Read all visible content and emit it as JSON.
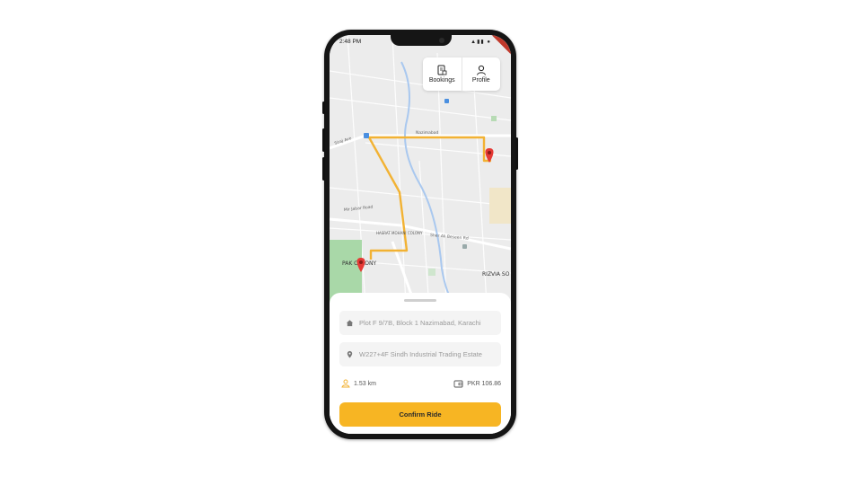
{
  "status_bar": {
    "time": "2:48 PM",
    "icons": "⚙"
  },
  "nav": {
    "bookings_label": "Bookings",
    "profile_label": "Profile"
  },
  "map": {
    "road_labels": [
      "Nazimabad",
      "Mir Jabar Road",
      "Sher Ali Beseen Rd",
      "Siraj Ave"
    ],
    "area_labels": [
      "HASRAT MOHANI COLONY",
      "PAK COLONY",
      "RIZVIA SO"
    ],
    "route_color": "#f2b233",
    "marker_color": "#e53935"
  },
  "ride": {
    "pickup": "Plot F 9/7B, Block 1 Nazimabad, Karachi",
    "dropoff": "W227+4F Sindh Industrial Trading Estate",
    "distance": "1.53 km",
    "fare": "PKR 106.86",
    "confirm_label": "Confirm Ride"
  },
  "colors": {
    "accent": "#f7b523",
    "map_bg": "#ececec"
  }
}
